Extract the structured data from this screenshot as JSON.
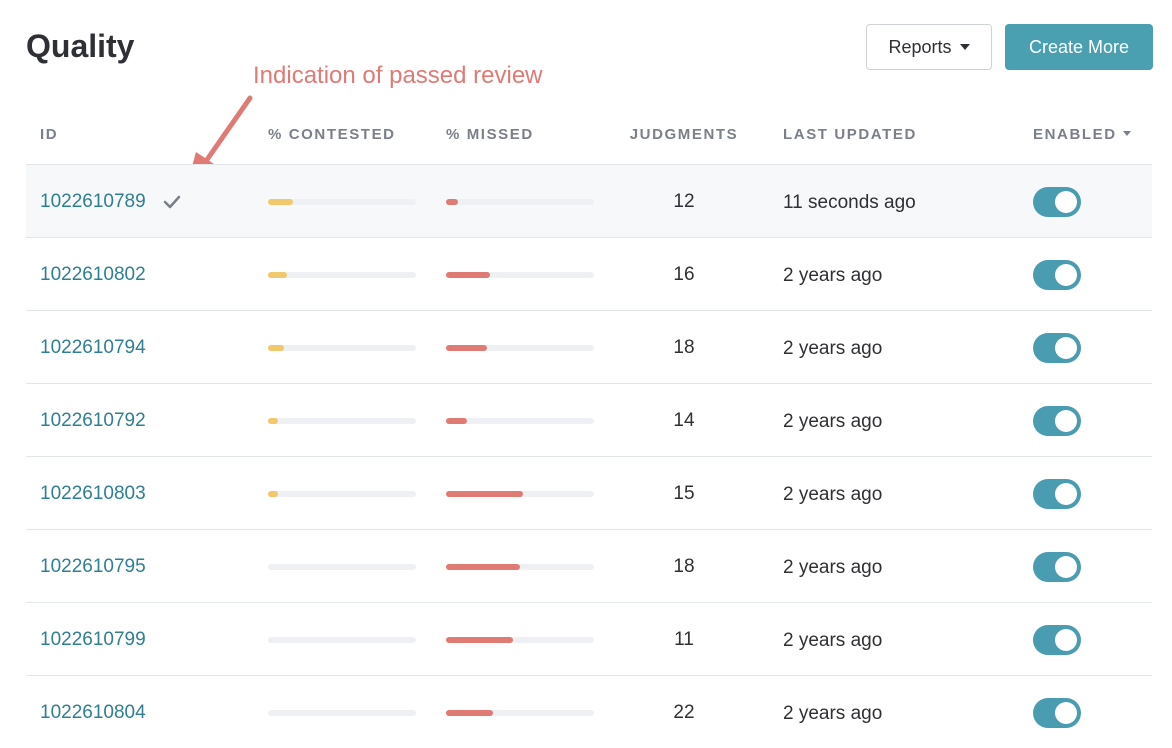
{
  "page": {
    "title": "Quality"
  },
  "actions": {
    "reports_label": "Reports",
    "create_label": "Create More"
  },
  "annotation": {
    "text": "Indication of passed review"
  },
  "colors": {
    "accent": "#4aa0b0",
    "link": "#2f7f92",
    "contested_bar": "#f2c86d",
    "missed_bar": "#e07a74",
    "annotation": "#e07a74"
  },
  "icons": {
    "check": "check-icon",
    "caret": "caret-down-icon"
  },
  "table": {
    "headers": {
      "id": "ID",
      "contested": "% CONTESTED",
      "missed": "% MISSED",
      "judgments": "JUDGMENTS",
      "updated": "LAST UPDATED",
      "enabled": "ENABLED"
    },
    "rows": [
      {
        "id": "1022610789",
        "passed": true,
        "contested": 0.17,
        "missed": 0.08,
        "judgments": "12",
        "updated": "11 seconds ago",
        "enabled": true
      },
      {
        "id": "1022610802",
        "passed": false,
        "contested": 0.13,
        "missed": 0.3,
        "judgments": "16",
        "updated": "2 years ago",
        "enabled": true
      },
      {
        "id": "1022610794",
        "passed": false,
        "contested": 0.11,
        "missed": 0.28,
        "judgments": "18",
        "updated": "2 years ago",
        "enabled": true
      },
      {
        "id": "1022610792",
        "passed": false,
        "contested": 0.07,
        "missed": 0.14,
        "judgments": "14",
        "updated": "2 years ago",
        "enabled": true
      },
      {
        "id": "1022610803",
        "passed": false,
        "contested": 0.07,
        "missed": 0.52,
        "judgments": "15",
        "updated": "2 years ago",
        "enabled": true
      },
      {
        "id": "1022610795",
        "passed": false,
        "contested": 0.0,
        "missed": 0.5,
        "judgments": "18",
        "updated": "2 years ago",
        "enabled": true
      },
      {
        "id": "1022610799",
        "passed": false,
        "contested": 0.0,
        "missed": 0.45,
        "judgments": "11",
        "updated": "2 years ago",
        "enabled": true
      },
      {
        "id": "1022610804",
        "passed": false,
        "contested": 0.0,
        "missed": 0.32,
        "judgments": "22",
        "updated": "2 years ago",
        "enabled": true
      }
    ]
  }
}
